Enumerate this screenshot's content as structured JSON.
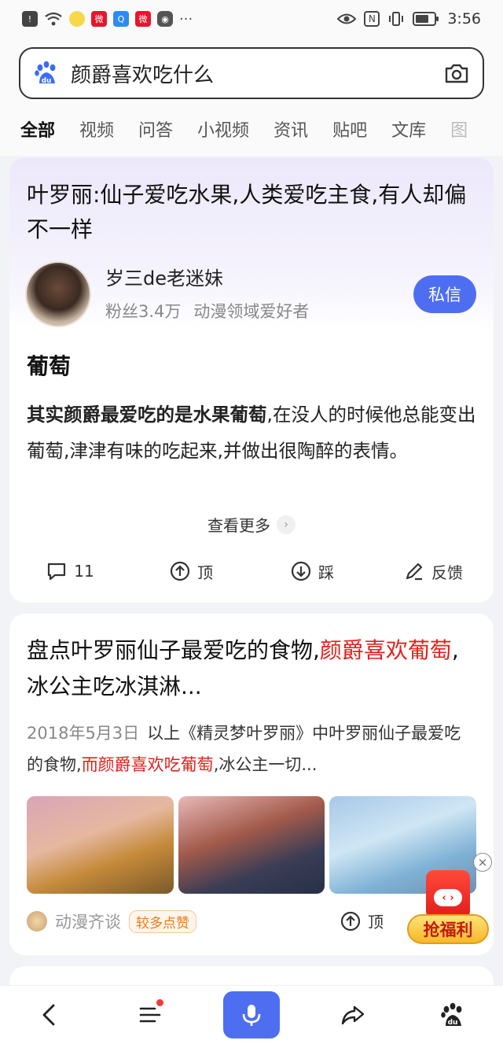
{
  "status_bar": {
    "time": "3:56",
    "icons": [
      "notification-icon",
      "wifi-icon",
      "app-icon",
      "weibo-icon",
      "search-app-icon",
      "weibo-icon",
      "vpn-icon",
      "more-icon",
      "eye-icon",
      "nfc-icon",
      "vibrate-icon",
      "battery-icon"
    ]
  },
  "search": {
    "query": "颜爵喜欢吃什么"
  },
  "tabs": [
    "全部",
    "视频",
    "问答",
    "小视频",
    "资讯",
    "贴吧",
    "文库",
    "图"
  ],
  "card1": {
    "title": "叶罗丽:仙子爱吃水果,人类爱吃主食,有人却偏不一样",
    "author_name": "岁三de老迷妹",
    "author_fans": "粉丝3.4万",
    "author_desc": "动漫领域爱好者",
    "dm_label": "私信",
    "heading": "葡萄",
    "body_bold": "其实颜爵最爱吃的是水果葡萄",
    "body_rest": ",在没人的时候他总能变出葡萄,津津有味的吃起来,并做出很陶醉的表情。",
    "see_more": "查看更多",
    "comment_count": "11",
    "up_label": "顶",
    "down_label": "踩",
    "feedback_label": "反馈"
  },
  "card2": {
    "title_part1": "盘点叶罗丽仙子最爱吃的食物,",
    "title_red": "颜爵喜欢葡萄",
    "title_part2": ",冰公主吃冰淇淋...",
    "date": "2018年5月3日",
    "snippet_part1": "以上《精灵梦叶罗丽》中叶罗丽仙子最爱吃的食物,",
    "snippet_red": "而颜爵喜欢吃葡萄",
    "snippet_part2": ",冰公主一切...",
    "source": "动漫齐谈",
    "badge": "较多点赞",
    "up_label": "顶"
  },
  "promo": {
    "label": "抢福利"
  },
  "colors": {
    "accent": "#4e6ef2",
    "highlight_red": "#e2211c",
    "badge_orange": "#ee7b1a"
  }
}
